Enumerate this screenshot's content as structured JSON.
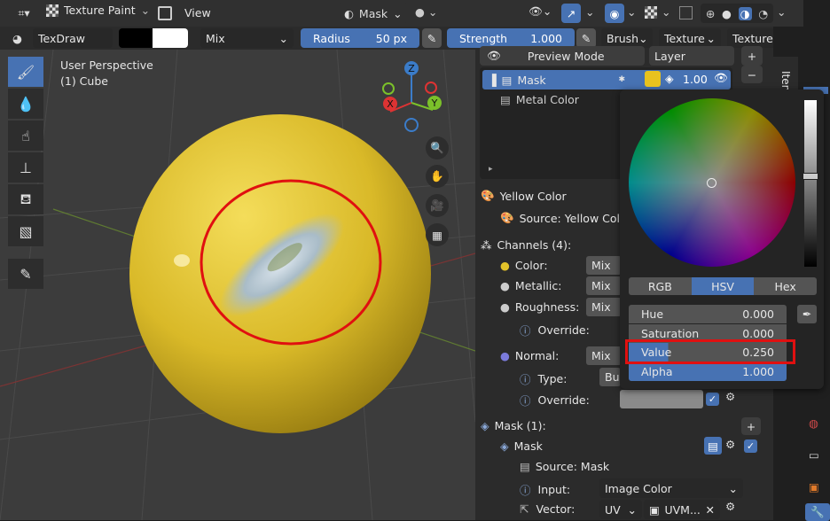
{
  "header": {
    "mode_label": "Texture Paint",
    "view_label": "View",
    "mask_label": "Mask"
  },
  "toolbar": {
    "brush_name": "TexDraw",
    "blend_mode": "Mix",
    "radius_label": "Radius",
    "radius_value": "50 px",
    "strength_label": "Strength",
    "strength_value": "1.000",
    "brush_menu": "Brush",
    "texture_menu": "Texture",
    "texture_mask_menu": "Texture Mask"
  },
  "viewport": {
    "perspective": "User Perspective",
    "object": "(1) Cube",
    "gizmo": {
      "z": "Z",
      "x": "X",
      "y": "Y"
    }
  },
  "panel": {
    "preview_mode": "Preview Mode",
    "layer": "Layer",
    "layers": [
      {
        "name": "Mask",
        "value": "1.00"
      },
      {
        "name": "Metal Color"
      }
    ],
    "yellow_color": "Yellow Color",
    "source_label": "Source: Yellow Color",
    "channels_label": "Channels (4):",
    "channels": [
      {
        "name": "Color:",
        "blend": "Mix"
      },
      {
        "name": "Metallic:",
        "blend": "Mix"
      },
      {
        "name": "Roughness:",
        "blend": "Mix"
      }
    ],
    "override": "Override:",
    "normal": "Normal:",
    "normal_blend": "Mix",
    "type_label": "Type:",
    "type_value": "Bu",
    "override2": "Override:",
    "mask_header": "Mask (1):",
    "mask_item": "Mask",
    "mask_source": "Source: Mask",
    "input_label": "Input:",
    "input_value": "Image Color",
    "vector_label": "Vector:",
    "vector_value": "UV",
    "vector_map": "UVM..."
  },
  "picker": {
    "tabs": [
      "RGB",
      "HSV",
      "Hex"
    ],
    "active_tab": "HSV",
    "fields": [
      {
        "label": "Hue",
        "value": "0.000"
      },
      {
        "label": "Saturation",
        "value": "0.000"
      },
      {
        "label": "Value",
        "value": "0.250"
      },
      {
        "label": "Alpha",
        "value": "1.000"
      }
    ]
  },
  "sidebar": {
    "item_tab": "Item"
  },
  "colors": {
    "accent": "#4772b3",
    "highlight": "#e01010",
    "sphere": "#e2c22a"
  }
}
